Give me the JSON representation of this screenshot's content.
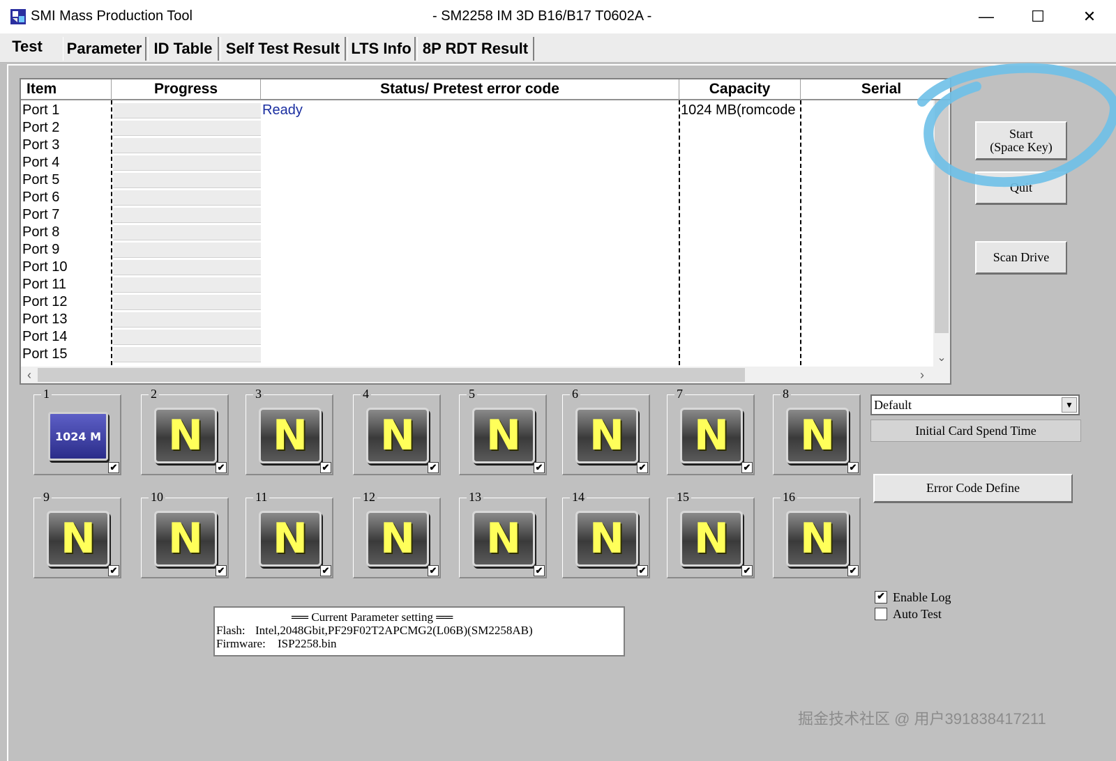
{
  "window": {
    "app_title": "SMI Mass Production Tool",
    "center_title": "- SM2258 IM 3D B16/B17 T0602A -",
    "minimize_glyph": "—",
    "maximize_glyph": "☐",
    "close_glyph": "✕"
  },
  "tabs": [
    "Test",
    "Parameter",
    "ID Table",
    "Self Test Result",
    "LTS Info",
    "8P RDT Result"
  ],
  "list": {
    "headers": [
      "Item",
      "Progress",
      "Status/ Pretest error code",
      "Capacity",
      "Serial"
    ],
    "rows": [
      {
        "item": "Port 1",
        "status": "Ready",
        "capacity": "1024 MB(romcode"
      },
      {
        "item": "Port 2",
        "status": "",
        "capacity": ""
      },
      {
        "item": "Port 3",
        "status": "",
        "capacity": ""
      },
      {
        "item": "Port 4",
        "status": "",
        "capacity": ""
      },
      {
        "item": "Port 5",
        "status": "",
        "capacity": ""
      },
      {
        "item": "Port 6",
        "status": "",
        "capacity": ""
      },
      {
        "item": "Port 7",
        "status": "",
        "capacity": ""
      },
      {
        "item": "Port 8",
        "status": "",
        "capacity": ""
      },
      {
        "item": "Port 9",
        "status": "",
        "capacity": ""
      },
      {
        "item": "Port 10",
        "status": "",
        "capacity": ""
      },
      {
        "item": "Port 11",
        "status": "",
        "capacity": ""
      },
      {
        "item": "Port 12",
        "status": "",
        "capacity": ""
      },
      {
        "item": "Port 13",
        "status": "",
        "capacity": ""
      },
      {
        "item": "Port 14",
        "status": "",
        "capacity": ""
      },
      {
        "item": "Port 15",
        "status": "",
        "capacity": ""
      }
    ],
    "scroll_left": "‹",
    "scroll_right": "›",
    "scroll_down": "⌄"
  },
  "buttons": {
    "start_line1": "Start",
    "start_line2": "(Space Key)",
    "quit": "Quit",
    "scan_drive": "Scan Drive",
    "error_code_define": "Error Code Define"
  },
  "slots": [
    {
      "num": "1",
      "label": "1024 M",
      "checked": true
    },
    {
      "num": "2",
      "label": "N",
      "checked": true
    },
    {
      "num": "3",
      "label": "N",
      "checked": true
    },
    {
      "num": "4",
      "label": "N",
      "checked": true
    },
    {
      "num": "5",
      "label": "N",
      "checked": true
    },
    {
      "num": "6",
      "label": "N",
      "checked": true
    },
    {
      "num": "7",
      "label": "N",
      "checked": true
    },
    {
      "num": "8",
      "label": "N",
      "checked": true
    },
    {
      "num": "9",
      "label": "N",
      "checked": true
    },
    {
      "num": "10",
      "label": "N",
      "checked": true
    },
    {
      "num": "11",
      "label": "N",
      "checked": true
    },
    {
      "num": "12",
      "label": "N",
      "checked": true
    },
    {
      "num": "13",
      "label": "N",
      "checked": true
    },
    {
      "num": "14",
      "label": "N",
      "checked": true
    },
    {
      "num": "15",
      "label": "N",
      "checked": true
    },
    {
      "num": "16",
      "label": "N",
      "checked": true
    }
  ],
  "settings": {
    "profile_select": "Default",
    "initial_card_label": "Initial Card Spend Time",
    "enable_log": "Enable Log",
    "enable_log_checked": true,
    "auto_test": "Auto Test",
    "auto_test_checked": false,
    "check_glyph": "✔"
  },
  "param_box": {
    "heading": "══ Current Parameter setting ══",
    "flash_key": "Flash:",
    "flash_value": "Intel,2048Gbit,PF29F02T2APCMG2(L06B)(SM2258AB)",
    "firmware_key": "Firmware:",
    "firmware_value": "ISP2258.bin"
  },
  "watermark": "掘金技术社区 @ 用户391838417211",
  "colors": {
    "status_text": "#1a2ea0",
    "annotation_circle": "#6ec0e8",
    "n_letter": "#ffff5a",
    "m_tile": "#3a3ca8"
  }
}
